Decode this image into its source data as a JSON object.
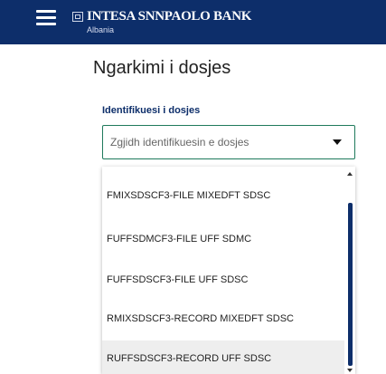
{
  "header": {
    "brand_name": "INTESA SNNPAOLO BANK",
    "brand_sub": "Albania",
    "colors": {
      "header_bg": "#0d2e6a",
      "accent": "#1f7a5c"
    }
  },
  "main": {
    "title": "Ngarkimi i dosjes",
    "field_label": "Identifikuesi i dosjes",
    "select_placeholder": "Zgjidh identifikuesin e dosjes"
  },
  "dropdown": {
    "options": [
      {
        "label": "FMIXSDSCF3-FILE MIXEDFT SDSC"
      },
      {
        "label": "FUFFSDMCF3-FILE UFF SDMC"
      },
      {
        "label": "FUFFSDSCF3-FILE UFF SDSC"
      },
      {
        "label": "RMIXSDSCF3-RECORD MIXEDFT SDSC"
      },
      {
        "label": "RUFFSDSCF3-RECORD UFF SDSC"
      }
    ],
    "highlighted_index": 4
  }
}
